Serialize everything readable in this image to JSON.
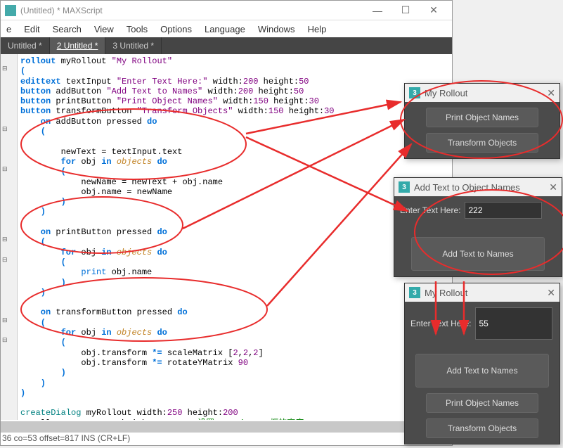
{
  "window": {
    "title": "(Untitled) * MAXScript",
    "minimize": "—",
    "maximize": "☐",
    "close": "✕"
  },
  "menu": [
    "e",
    "Edit",
    "Search",
    "View",
    "Tools",
    "Options",
    "Language",
    "Windows",
    "Help"
  ],
  "tabs": [
    {
      "label": "Untitled *",
      "active": false
    },
    {
      "label": "2 Untitled *",
      "active": true
    },
    {
      "label": "3 Untitled *",
      "active": false
    }
  ],
  "code": {
    "l1": {
      "a": "rollout",
      "b": " myRollout ",
      "c": "\"My Rollout\""
    },
    "l2": "(",
    "l3": {
      "a": "edittext",
      "b": " textInput ",
      "c": "\"Enter Text Here:\"",
      "d": " width:",
      "e": "200",
      "f": " height:",
      "g": "50"
    },
    "l4": {
      "a": "button",
      "b": " addButton ",
      "c": "\"Add Text to Names\"",
      "d": " width:",
      "e": "200",
      "f": " height:",
      "g": "50"
    },
    "l5": {
      "a": "button",
      "b": " printButton ",
      "c": "\"Print Object Names\"",
      "d": " width:",
      "e": "150",
      "f": " height:",
      "g": "30"
    },
    "l6": {
      "a": "button",
      "b": " transformButton ",
      "c": "\"Transform Objects\"",
      "d": " width:",
      "e": "150",
      "f": " height:",
      "g": "30"
    },
    "l7": {
      "a": "    on",
      "b": " addButton pressed ",
      "c": "do"
    },
    "l8": "    (",
    "l9": "",
    "l10": "        newText = textInput.text",
    "l11": {
      "a": "        for",
      "b": " obj ",
      "c": "in",
      "d": " ",
      "e": "objects",
      "f": " ",
      "g": "do"
    },
    "l12": "        (",
    "l13": "            newName = newText + obj.name",
    "l14": "            obj.name = newName",
    "l15": "        )",
    "l16": "    )",
    "l17": "",
    "l18": {
      "a": "    on",
      "b": " printButton pressed ",
      "c": "do"
    },
    "l19": "    (",
    "l20": {
      "a": "        for",
      "b": " obj ",
      "c": "in",
      "d": " ",
      "e": "objects",
      "f": " ",
      "g": "do"
    },
    "l21": "        (",
    "l22": {
      "a": "            ",
      "b": "print",
      "c": " obj.name"
    },
    "l23": "        )",
    "l24": "    )",
    "l25": "",
    "l26": {
      "a": "    on",
      "b": " transformButton pressed ",
      "c": "do"
    },
    "l27": "    (",
    "l28": {
      "a": "        for",
      "b": " obj ",
      "c": "in",
      "d": " ",
      "e": "objects",
      "f": " ",
      "g": "do"
    },
    "l29": "        (",
    "l30": {
      "a": "            obj.transform ",
      "b": "*=",
      "c": " scaleMatrix [",
      "d": "2",
      "e": ",",
      "f": "2",
      "g": ",",
      "h": "2",
      "i": "]"
    },
    "l31": {
      "a": "            obj.transform ",
      "b": "*=",
      "c": " rotateYMatrix ",
      "d": "90"
    },
    "l32": "        )",
    "l33": "    )",
    "l34": ")",
    "l35": "",
    "l36": {
      "a": "createDialog",
      "b": " myRollout width:",
      "c": "250",
      "d": " height:",
      "e": "200"
    },
    "l37": {
      "a": "myRollout.textInput.height = ",
      "b": "30",
      "c": " -- 设置 textinput 框的高度"
    }
  },
  "status": "36 co=53 offset=817 INS (CR+LF)",
  "panel1": {
    "title": "My Rollout",
    "btn1": "Print Object Names",
    "btn2": "Transform Objects"
  },
  "panel2": {
    "title": "Add Text to Object Names",
    "label": "Enter Text Here:",
    "value": "222",
    "btn": "Add Text to Names"
  },
  "panel3": {
    "title": "My Rollout",
    "label": "Enter Text Here:",
    "value": "55",
    "btn1": "Add Text to Names",
    "btn2": "Print Object Names",
    "btn3": "Transform Objects"
  }
}
